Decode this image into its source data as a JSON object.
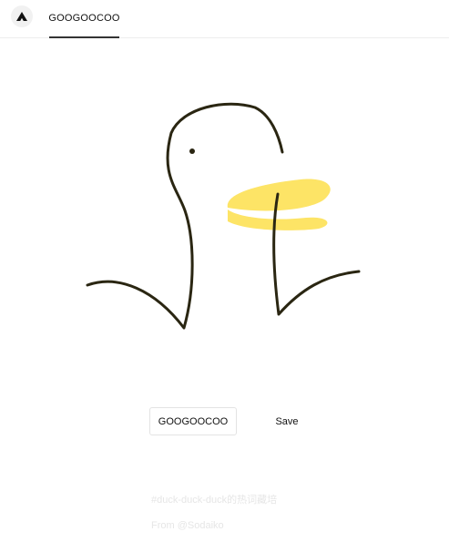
{
  "header": {
    "logo_icon": "triangle-logo-icon",
    "tab_label": "GOOGOOCOO"
  },
  "canvas": {
    "drawing": "duck-drawing",
    "stroke_color": "#2a2612",
    "beak_color": "#fde466"
  },
  "actions": {
    "name_button_label": "GOOGOOCOO",
    "save_label": "Save"
  },
  "footer": {
    "tagline": "#duck-duck-duck的热词藏培",
    "credit": "From @Sodaiko"
  }
}
